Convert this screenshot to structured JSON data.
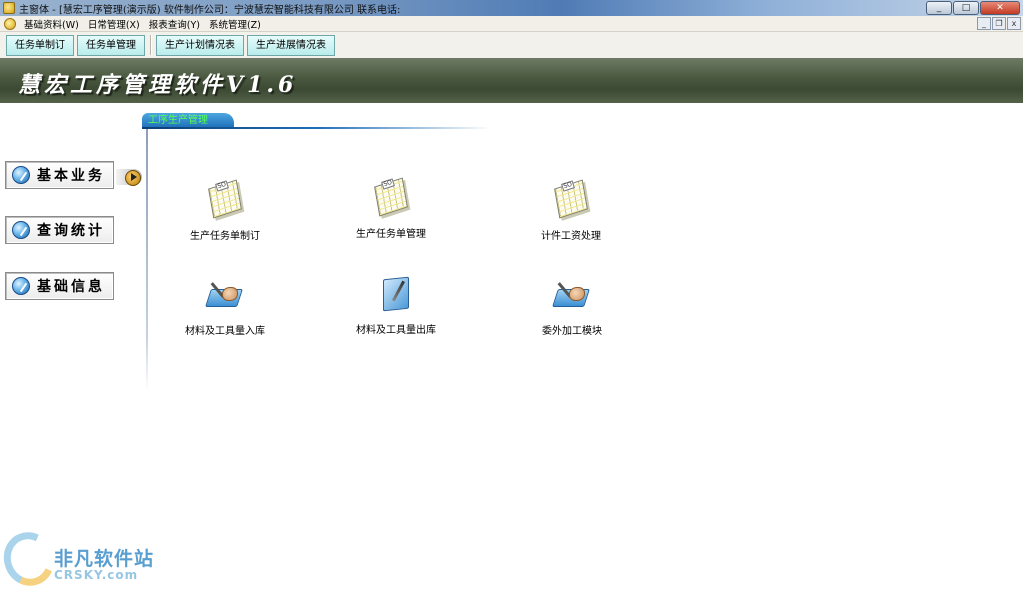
{
  "window": {
    "title": "主窗体 - [慧宏工序管理(演示版) 软件制作公司：宁波慧宏智能科技有限公司 联系电话:",
    "controls": {
      "minimize": "_",
      "maximize": "□",
      "close": "✕"
    }
  },
  "menubar": {
    "items": [
      {
        "label": "基础资料(W)"
      },
      {
        "label": "日常管理(X)"
      },
      {
        "label": "报表查询(Y)"
      },
      {
        "label": "系统管理(Z)"
      }
    ],
    "mdi_controls": {
      "minimize": "_",
      "restore": "❐",
      "close": "x"
    }
  },
  "toolbar": {
    "buttons": [
      {
        "label": "任务单制订"
      },
      {
        "label": "任务单管理"
      },
      {
        "label": "生产计划情况表"
      },
      {
        "label": "生产进展情况表"
      }
    ]
  },
  "banner": {
    "title": "慧宏工序管理软件V1.6"
  },
  "content": {
    "tab_title": "工序生产管理"
  },
  "nav": {
    "items": [
      {
        "label": "基本业务",
        "active": true
      },
      {
        "label": "查询统计",
        "active": false
      },
      {
        "label": "基础信息",
        "active": false
      }
    ]
  },
  "modules": [
    {
      "label": "生产任务单制订",
      "icon": "document-icon"
    },
    {
      "label": "生产任务单管理",
      "icon": "document-icon"
    },
    {
      "label": "计件工资处理",
      "icon": "document-icon"
    },
    {
      "label": "材料及工具量入库",
      "icon": "tray-hand-icon"
    },
    {
      "label": "材料及工具量出库",
      "icon": "folder-pen-icon"
    },
    {
      "label": "委外加工模块",
      "icon": "tray-hand-icon"
    }
  ],
  "watermark": {
    "text": "非凡软件站",
    "sub": "CRSKY.com"
  }
}
